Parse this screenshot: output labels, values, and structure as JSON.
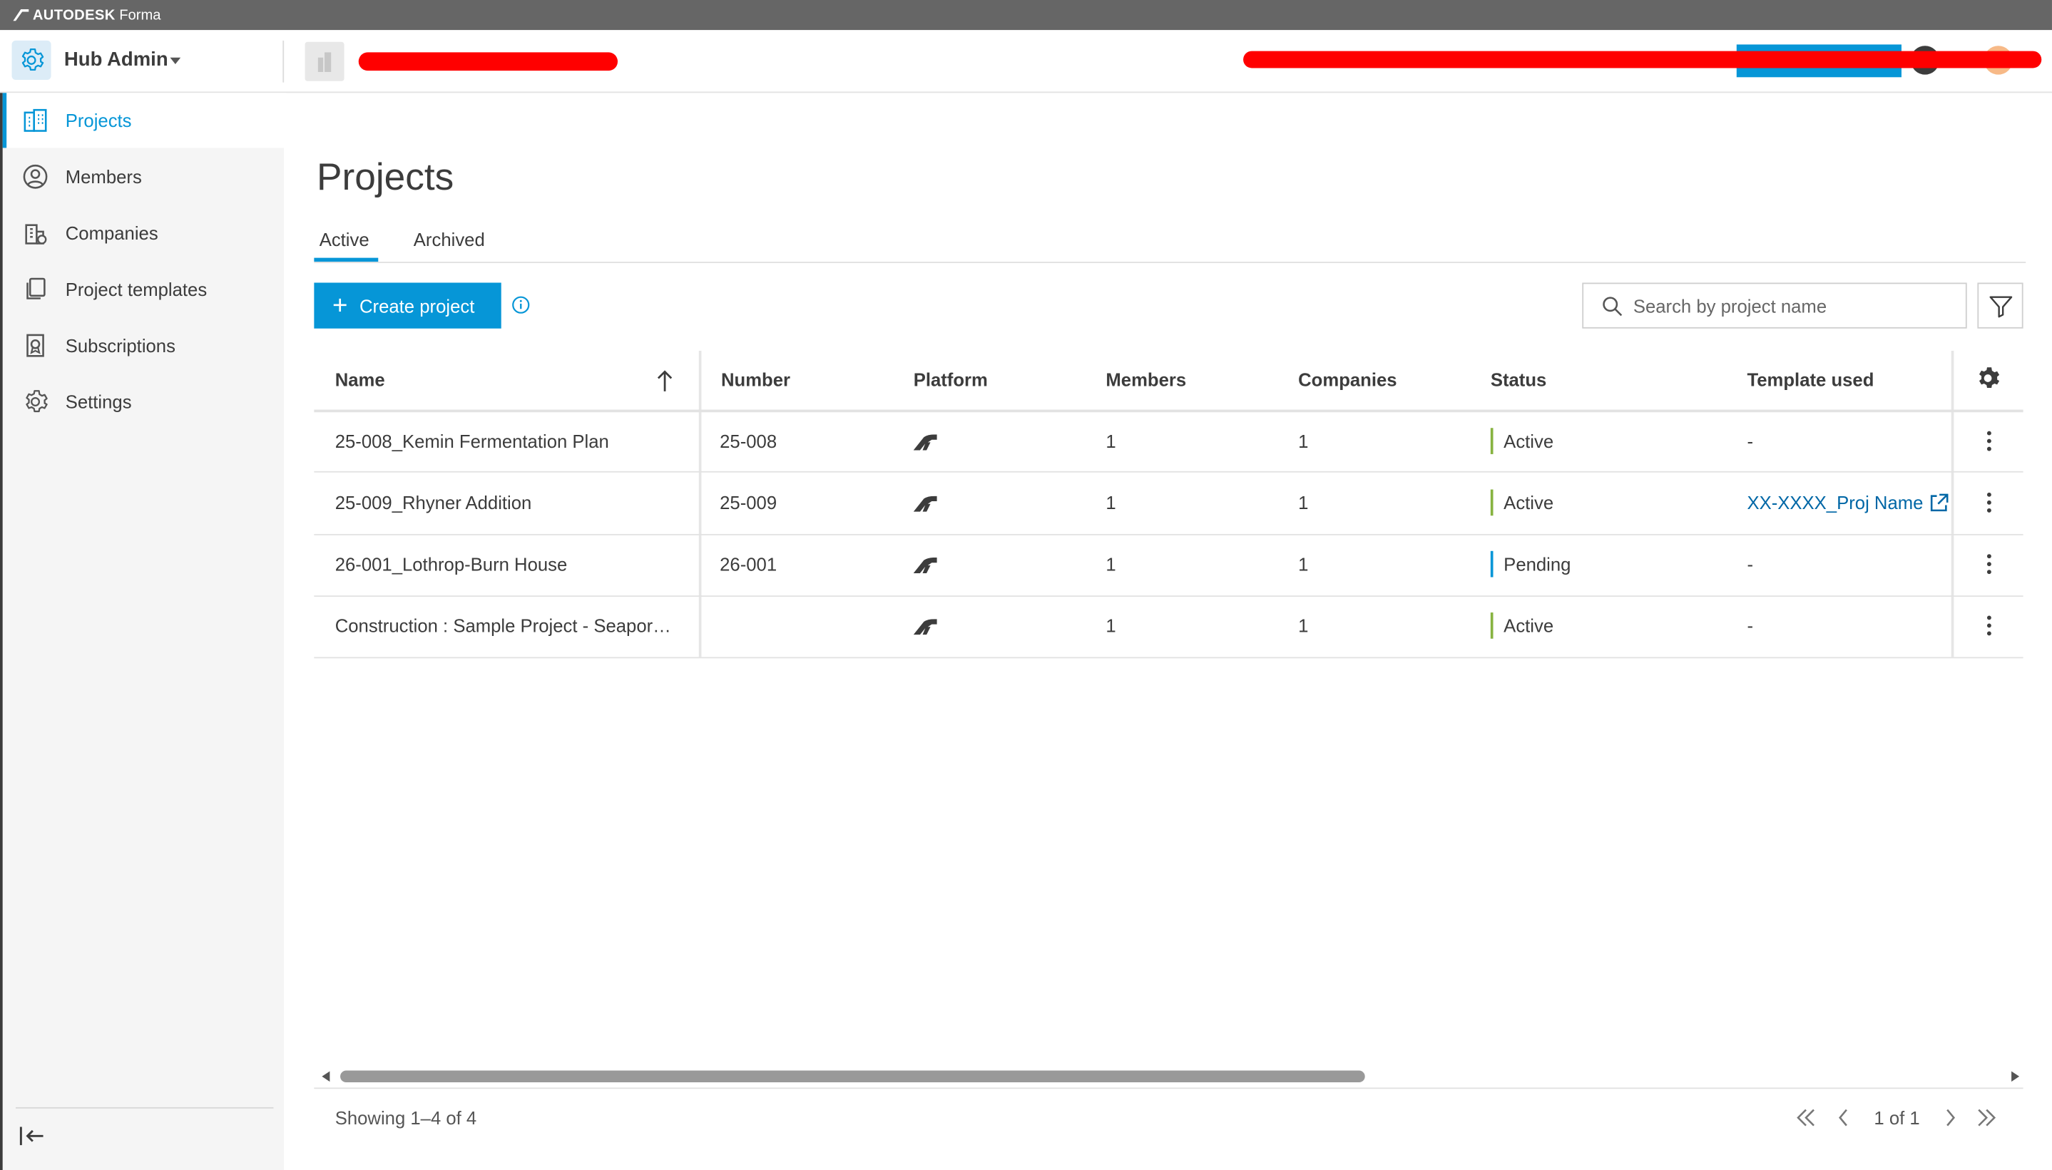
{
  "brand": {
    "company": "AUTODESK",
    "product": "Forma"
  },
  "header": {
    "hub_title": "Hub Admin"
  },
  "sidebar": {
    "items": [
      {
        "label": "Projects",
        "icon": "building-icon",
        "active": true
      },
      {
        "label": "Members",
        "icon": "person-circle-icon"
      },
      {
        "label": "Companies",
        "icon": "company-icon"
      },
      {
        "label": "Project templates",
        "icon": "template-icon"
      },
      {
        "label": "Subscriptions",
        "icon": "subscription-icon"
      },
      {
        "label": "Settings",
        "icon": "gear-icon"
      }
    ]
  },
  "main": {
    "title": "Projects",
    "tabs": [
      {
        "label": "Active",
        "active": true
      },
      {
        "label": "Archived"
      }
    ],
    "create_label": "Create project",
    "search_placeholder": "Search by project name"
  },
  "table": {
    "columns": [
      "Name",
      "Number",
      "Platform",
      "Members",
      "Companies",
      "Status",
      "Template used"
    ],
    "rows": [
      {
        "name": "25-008_Kemin Fermentation Plan",
        "number": "25-008",
        "platform": "forma-logo-icon",
        "members": "1",
        "companies": "1",
        "status": "Active",
        "template": "-"
      },
      {
        "name": "25-009_Rhyner Addition",
        "number": "25-009",
        "platform": "forma-logo-icon",
        "members": "1",
        "companies": "1",
        "status": "Active",
        "template": "XX-XXXX_Proj Name"
      },
      {
        "name": "26-001_Lothrop-Burn House",
        "number": "26-001",
        "platform": "forma-logo-icon",
        "members": "1",
        "companies": "1",
        "status": "Pending",
        "template": "-"
      },
      {
        "name": "Construction : Sample Project - Seapor…",
        "number": "",
        "platform": "forma-logo-icon",
        "members": "1",
        "companies": "1",
        "status": "Active",
        "template": "-"
      }
    ]
  },
  "pager": {
    "showing": "Showing 1–4 of 4",
    "page": "1 of 1"
  },
  "colors": {
    "accent": "#0696d7",
    "active_status": "#87b340",
    "pending_status": "#0696d7",
    "brand_bar": "#666666"
  }
}
